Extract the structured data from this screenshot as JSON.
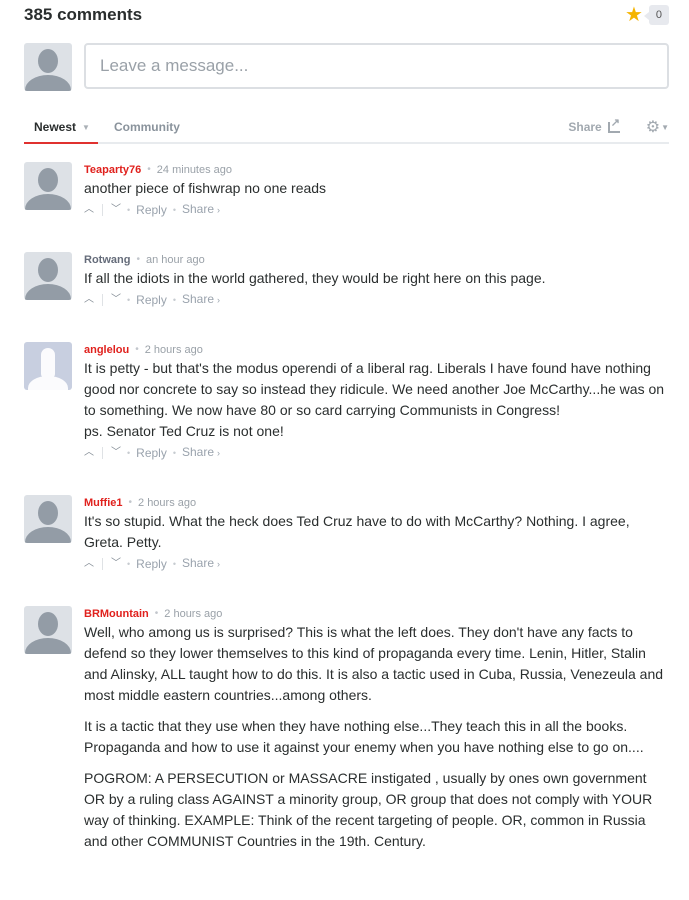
{
  "header": {
    "comment_count_label": "385 comments",
    "recommend_icon": "star-icon",
    "recommend_count": "0"
  },
  "composer": {
    "placeholder": "Leave a message...",
    "value": ""
  },
  "nav": {
    "tabs": [
      {
        "label": "Newest",
        "active": true
      },
      {
        "label": "Community",
        "active": false
      }
    ],
    "share_label": "Share",
    "share_icon": "share-icon",
    "settings_icon": "gear-icon"
  },
  "colors": {
    "accent": "#e0312f",
    "author_red": "#e0211d",
    "star": "#f5b400"
  },
  "actions": {
    "upvote_glyph": "^",
    "downvote_glyph": "v",
    "reply_label": "Reply",
    "share_label": "Share",
    "share_chevron": "›",
    "dot": "•"
  },
  "comments": [
    {
      "author": "Teaparty76",
      "author_style": "red",
      "time": "24 minutes ago",
      "paragraphs": [
        "another piece of fishwrap no one reads"
      ]
    },
    {
      "author": "Rotwang",
      "author_style": "gray",
      "time": "an hour ago",
      "paragraphs": [
        "If all the idiots in the world gathered, they would be right here on this page."
      ]
    },
    {
      "author": "anglelou",
      "author_style": "red",
      "avatar": "alt",
      "time": "2 hours ago",
      "paragraphs": [
        "It is petty - but that's the modus operendi of a liberal rag. Liberals I have found have nothing good nor concrete to say so instead they ridicule. We need another Joe McCarthy...he was on to something. We now have 80 or so card carrying Communists in Congress!\nps. Senator Ted Cruz is not one!"
      ]
    },
    {
      "author": "Muffie1",
      "author_style": "red",
      "time": "2 hours ago",
      "paragraphs": [
        "It's so stupid. What the heck does Ted Cruz have to do with McCarthy? Nothing. I agree, Greta. Petty."
      ]
    },
    {
      "author": "BRMountain",
      "author_style": "red",
      "time": "2 hours ago",
      "paragraphs": [
        "Well, who among us is surprised? This is what the left does. They don't have any facts to defend so they lower themselves to this kind of propaganda every time. Lenin, Hitler, Stalin and Alinsky, ALL taught how to do this. It is also a tactic used in Cuba, Russia, Venezeula and most middle eastern countries...among others.",
        "It is a tactic that they use when they have nothing else...They teach this in all the books. Propaganda and how to use it against your enemy when you have nothing else to go on....",
        "POGROM: A PERSECUTION or MASSACRE instigated , usually by ones own government OR by a ruling class AGAINST a minority group, OR group that does not comply with YOUR way of thinking. EXAMPLE: Think of the recent targeting of people. OR, common in Russia and other COMMUNIST Countries in the 19th. Century."
      ]
    }
  ]
}
